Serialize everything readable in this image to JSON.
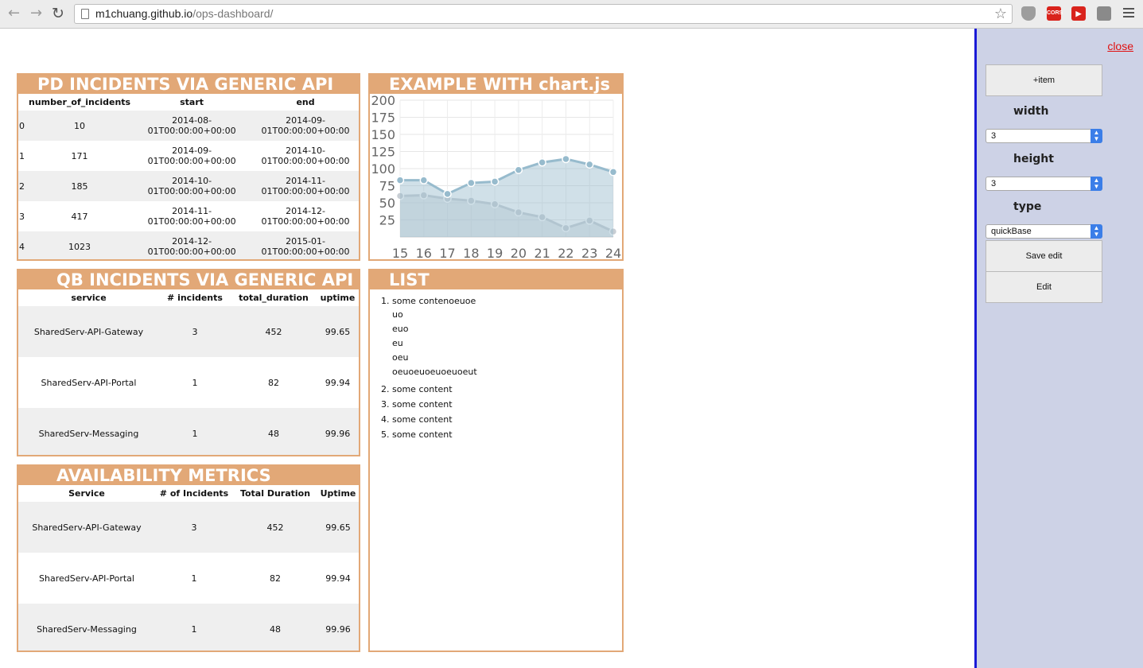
{
  "browser": {
    "url_host": "m1chuang.github.io",
    "url_path": "/ops-dashboard/",
    "extensions": [
      "shield-icon",
      "cors-icon",
      "youtube-icon",
      "ext-icon"
    ],
    "cors_label": "CORS"
  },
  "pd_panel": {
    "title": "PD INCIDENTS VIA GENERIC API",
    "columns": [
      "",
      "number_of_incidents",
      "start",
      "end"
    ],
    "rows": [
      [
        "0",
        "10",
        "2014-08-01T00:00:00+00:00",
        "2014-09-01T00:00:00+00:00"
      ],
      [
        "1",
        "171",
        "2014-09-01T00:00:00+00:00",
        "2014-10-01T00:00:00+00:00"
      ],
      [
        "2",
        "185",
        "2014-10-01T00:00:00+00:00",
        "2014-11-01T00:00:00+00:00"
      ],
      [
        "3",
        "417",
        "2014-11-01T00:00:00+00:00",
        "2014-12-01T00:00:00+00:00"
      ],
      [
        "4",
        "1023",
        "2014-12-01T00:00:00+00:00",
        "2015-01-01T00:00:00+00:00"
      ]
    ]
  },
  "chart_panel": {
    "title": "EXAMPLE WITH chart.js"
  },
  "chart_data": {
    "type": "area",
    "categories": [
      "15",
      "16",
      "17",
      "18",
      "19",
      "20",
      "21",
      "22",
      "23",
      "24"
    ],
    "series": [
      {
        "values": [
          83,
          83,
          63,
          79,
          81,
          98,
          109,
          114,
          106,
          95
        ],
        "color": "#97bbcd"
      },
      {
        "values": [
          60,
          61,
          56,
          53,
          48,
          36,
          29,
          13,
          24,
          8
        ],
        "color": "#c8ced4"
      }
    ],
    "yticks": [
      "200",
      "175",
      "150",
      "125",
      "100",
      "75",
      "50",
      "25"
    ],
    "ylim": [
      0,
      200
    ],
    "grid": true
  },
  "qb_panel": {
    "title": "QB INCIDENTS VIA GENERIC API",
    "columns": [
      "service",
      "# incidents",
      "total_duration",
      "uptime"
    ],
    "rows": [
      [
        "SharedServ-API-Gateway",
        "3",
        "452",
        "99.65"
      ],
      [
        "SharedServ-API-Portal",
        "1",
        "82",
        "99.94"
      ],
      [
        "SharedServ-Messaging",
        "1",
        "48",
        "99.96"
      ]
    ]
  },
  "list_panel": {
    "title": "LIST",
    "first_item": "some contenoeuoe",
    "first_sub": [
      "uo",
      "euo",
      "eu",
      "oeu",
      "oeuoeuoeuoeuoeut"
    ],
    "items": [
      "some content",
      "some content",
      "some content",
      "some content"
    ]
  },
  "avail_panel": {
    "title": "AVAILABILITY METRICS",
    "columns": [
      "Service",
      "# of Incidents",
      "Total Duration",
      "Uptime"
    ],
    "rows": [
      [
        "SharedServ-API-Gateway",
        "3",
        "452",
        "99.65"
      ],
      [
        "SharedServ-API-Portal",
        "1",
        "82",
        "99.94"
      ],
      [
        "SharedServ-Messaging",
        "1",
        "48",
        "99.96"
      ]
    ]
  },
  "side": {
    "close": "close",
    "add_item": "+item",
    "width_label": "width",
    "width_value": "3",
    "height_label": "height",
    "height_value": "3",
    "type_label": "type",
    "type_value": "quickBase",
    "save_edit": "Save edit",
    "edit": "Edit"
  }
}
